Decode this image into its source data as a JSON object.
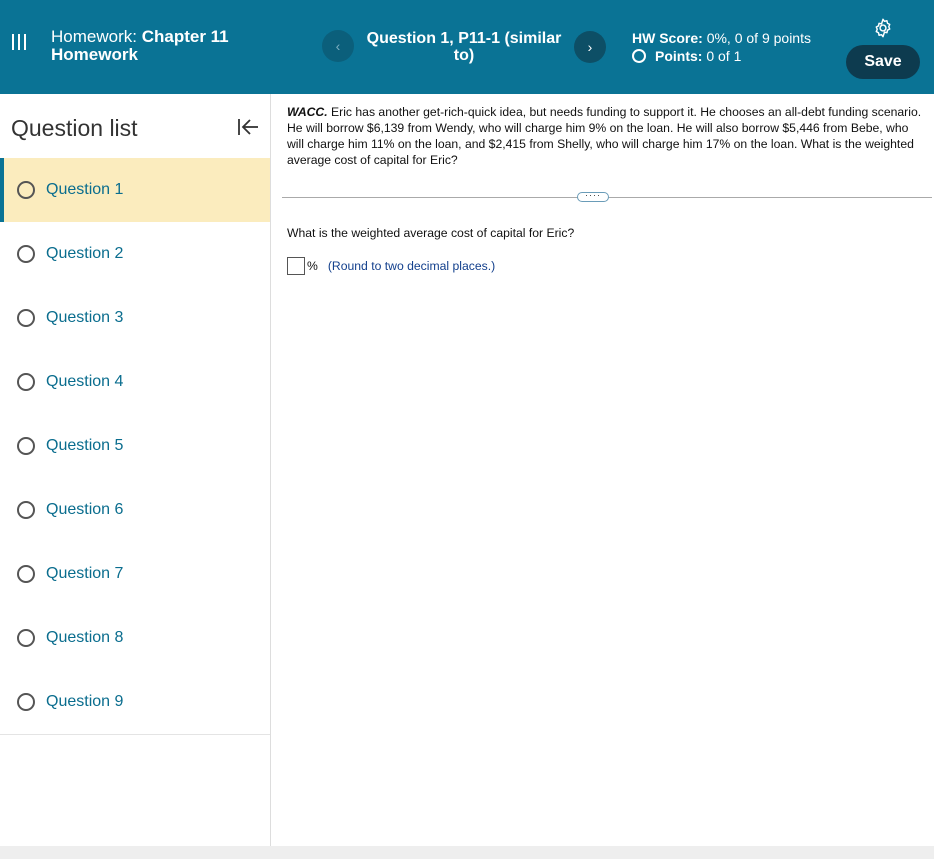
{
  "header": {
    "menu_icon": "hamburger-icon",
    "hw_label": "Homework:",
    "hw_name_line1": "Chapter 11",
    "hw_name_line2": "Homework",
    "question_title": "Question 1, P11-1 (similar to)",
    "prev_icon": "chevron-left-icon",
    "next_icon": "chevron-right-icon",
    "hw_score_label": "HW Score:",
    "hw_score_value": "0%, 0 of 9 points",
    "points_label": "Points:",
    "points_value": "0 of 1",
    "settings_icon": "gear-icon",
    "save_label": "Save",
    "brand_color": "#0a7395",
    "save_color": "#0d3b4f"
  },
  "sidebar": {
    "title": "Question list",
    "collapse_icon": "collapse-left-icon",
    "items": [
      {
        "label": "Question 1",
        "active": true
      },
      {
        "label": "Question 2",
        "active": false
      },
      {
        "label": "Question 3",
        "active": false
      },
      {
        "label": "Question 4",
        "active": false
      },
      {
        "label": "Question 5",
        "active": false
      },
      {
        "label": "Question 6",
        "active": false
      },
      {
        "label": "Question 7",
        "active": false
      },
      {
        "label": "Question 8",
        "active": false
      },
      {
        "label": "Question 9",
        "active": false
      }
    ],
    "active_color": "#fbecbe"
  },
  "main": {
    "problem_tag": "WACC.",
    "problem_text": "Eric has another get-rich-quick idea, but needs funding to support it.  He chooses an all-debt funding scenario.  He will borrow $6,139 from Wendy, who will charge him 9% on the loan.  He will also borrow $5,446 from Bebe, who will charge him 11% on the loan, and $2,415 from Shelly, who will charge him 17% on the loan.  What is the weighted average cost of capital for Eric?",
    "more_label": "····",
    "question": "What is the weighted average cost of capital for Eric?",
    "answer_value": "",
    "answer_unit": "%",
    "answer_hint": "(Round to two decimal places.)"
  }
}
